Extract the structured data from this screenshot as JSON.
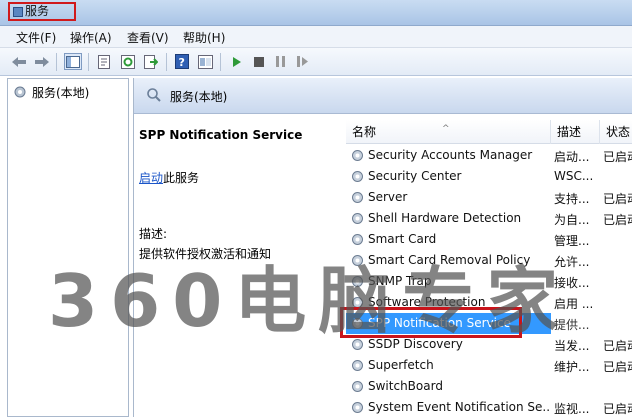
{
  "window": {
    "title": "服务"
  },
  "menu": {
    "items": [
      {
        "label": "文件(F)"
      },
      {
        "label": "操作(A)"
      },
      {
        "label": "查看(V)"
      },
      {
        "label": "帮助(H)"
      }
    ]
  },
  "toolbar": {
    "buttons": [
      "back-arrow",
      "forward-arrow",
      "show-tree",
      "properties",
      "refresh",
      "export",
      "help",
      "console",
      "start",
      "stop",
      "pause",
      "restart"
    ]
  },
  "tree": {
    "root_label": "服务(本地)"
  },
  "pane": {
    "header_label": "服务(本地)"
  },
  "detail": {
    "service_name": "SPP Notification Service",
    "start_link": "启动",
    "start_suffix": "此服务",
    "desc_label": "描述:",
    "desc_text": "提供软件授权激活和通知"
  },
  "list": {
    "columns": {
      "name": "名称",
      "desc": "描述",
      "status": "状态"
    },
    "rows": [
      {
        "name": "Security Accounts Manager",
        "desc": "启动...",
        "status": "已启动",
        "selected": false
      },
      {
        "name": "Security Center",
        "desc": "WSC...",
        "status": "",
        "selected": false
      },
      {
        "name": "Server",
        "desc": "支持...",
        "status": "已启动",
        "selected": false
      },
      {
        "name": "Shell Hardware Detection",
        "desc": "为自...",
        "status": "已启动",
        "selected": false
      },
      {
        "name": "Smart Card",
        "desc": "管理...",
        "status": "",
        "selected": false
      },
      {
        "name": "Smart Card Removal Policy",
        "desc": "允许...",
        "status": "",
        "selected": false
      },
      {
        "name": "SNMP Trap",
        "desc": "接收...",
        "status": "",
        "selected": false
      },
      {
        "name": "Software Protection",
        "desc": "启用 ...",
        "status": "",
        "selected": false
      },
      {
        "name": "SPP Notification Service",
        "desc": "提供...",
        "status": "",
        "selected": true
      },
      {
        "name": "SSDP Discovery",
        "desc": "当发...",
        "status": "已启动",
        "selected": false
      },
      {
        "name": "Superfetch",
        "desc": "维护...",
        "status": "已启动",
        "selected": false
      },
      {
        "name": "SwitchBoard",
        "desc": "",
        "status": "",
        "selected": false
      },
      {
        "name": "System Event Notification Se...",
        "desc": "监视...",
        "status": "已启动",
        "selected": false
      }
    ]
  },
  "watermark": {
    "text": "360电脑专家"
  },
  "colors": {
    "highlight": "#c8141b",
    "selection": "#3399ff",
    "link": "#1a55c8"
  }
}
